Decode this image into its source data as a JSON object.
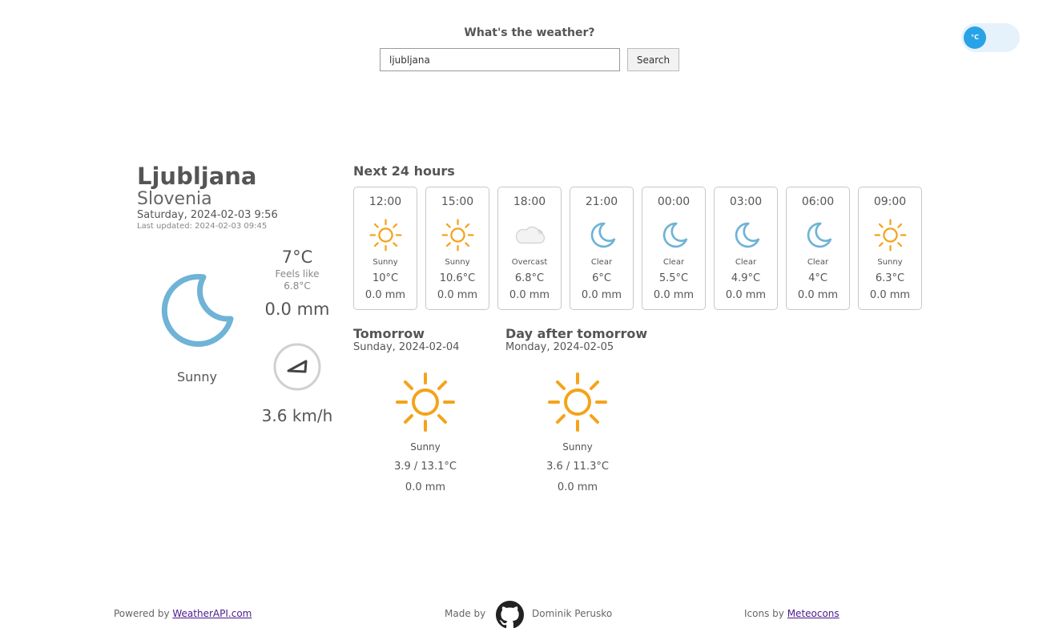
{
  "header": {
    "title": "What's the weather?",
    "search_value": "ljubljana",
    "search_button": "Search",
    "unit_toggle": "°C"
  },
  "current": {
    "city": "Ljubljana",
    "country": "Slovenia",
    "local_time": "Saturday, 2024-02-03 9:56",
    "last_updated": "Last updated: 2024-02-03 09:45",
    "icon": "moon-icon",
    "condition": "Sunny",
    "temp": "7°C",
    "feels_label": "Feels like",
    "feels_value": "6.8°C",
    "precip": "0.0 mm",
    "wind_icon": "wind-direction-icon",
    "wind_speed": "3.6 km/h"
  },
  "hourly": {
    "heading": "Next 24 hours",
    "items": [
      {
        "time": "12:00",
        "icon": "sun-icon",
        "condition": "Sunny",
        "temp": "10°C",
        "precip": "0.0 mm"
      },
      {
        "time": "15:00",
        "icon": "sun-icon",
        "condition": "Sunny",
        "temp": "10.6°C",
        "precip": "0.0 mm"
      },
      {
        "time": "18:00",
        "icon": "cloud-icon",
        "condition": "Overcast",
        "temp": "6.8°C",
        "precip": "0.0 mm"
      },
      {
        "time": "21:00",
        "icon": "moon-icon",
        "condition": "Clear",
        "temp": "6°C",
        "precip": "0.0 mm"
      },
      {
        "time": "00:00",
        "icon": "moon-icon",
        "condition": "Clear",
        "temp": "5.5°C",
        "precip": "0.0 mm"
      },
      {
        "time": "03:00",
        "icon": "moon-icon",
        "condition": "Clear",
        "temp": "4.9°C",
        "precip": "0.0 mm"
      },
      {
        "time": "06:00",
        "icon": "moon-icon",
        "condition": "Clear",
        "temp": "4°C",
        "precip": "0.0 mm"
      },
      {
        "time": "09:00",
        "icon": "sun-icon",
        "condition": "Sunny",
        "temp": "6.3°C",
        "precip": "0.0 mm"
      }
    ]
  },
  "forecast": [
    {
      "title": "Tomorrow",
      "date": "Sunday, 2024-02-04",
      "icon": "sun-icon",
      "condition": "Sunny",
      "temps": "3.9 / 13.1°C",
      "precip": "0.0 mm"
    },
    {
      "title": "Day after tomorrow",
      "date": "Monday, 2024-02-05",
      "icon": "sun-icon",
      "condition": "Sunny",
      "temps": "3.6 / 11.3°C",
      "precip": "0.0 mm"
    }
  ],
  "footer": {
    "powered_prefix": "Powered by",
    "powered_link": "WeatherAPI.com",
    "made_by_prefix": "Made by",
    "author": "Dominik Perusko",
    "icons_prefix": "Icons by",
    "icons_link": "Meteocons"
  },
  "colors": {
    "sun": "#f4a31a",
    "moon": "#6fb3d6",
    "cloud": "#e3e3e3",
    "toggle": "#29a3e8",
    "link": "#4a1a8a"
  }
}
